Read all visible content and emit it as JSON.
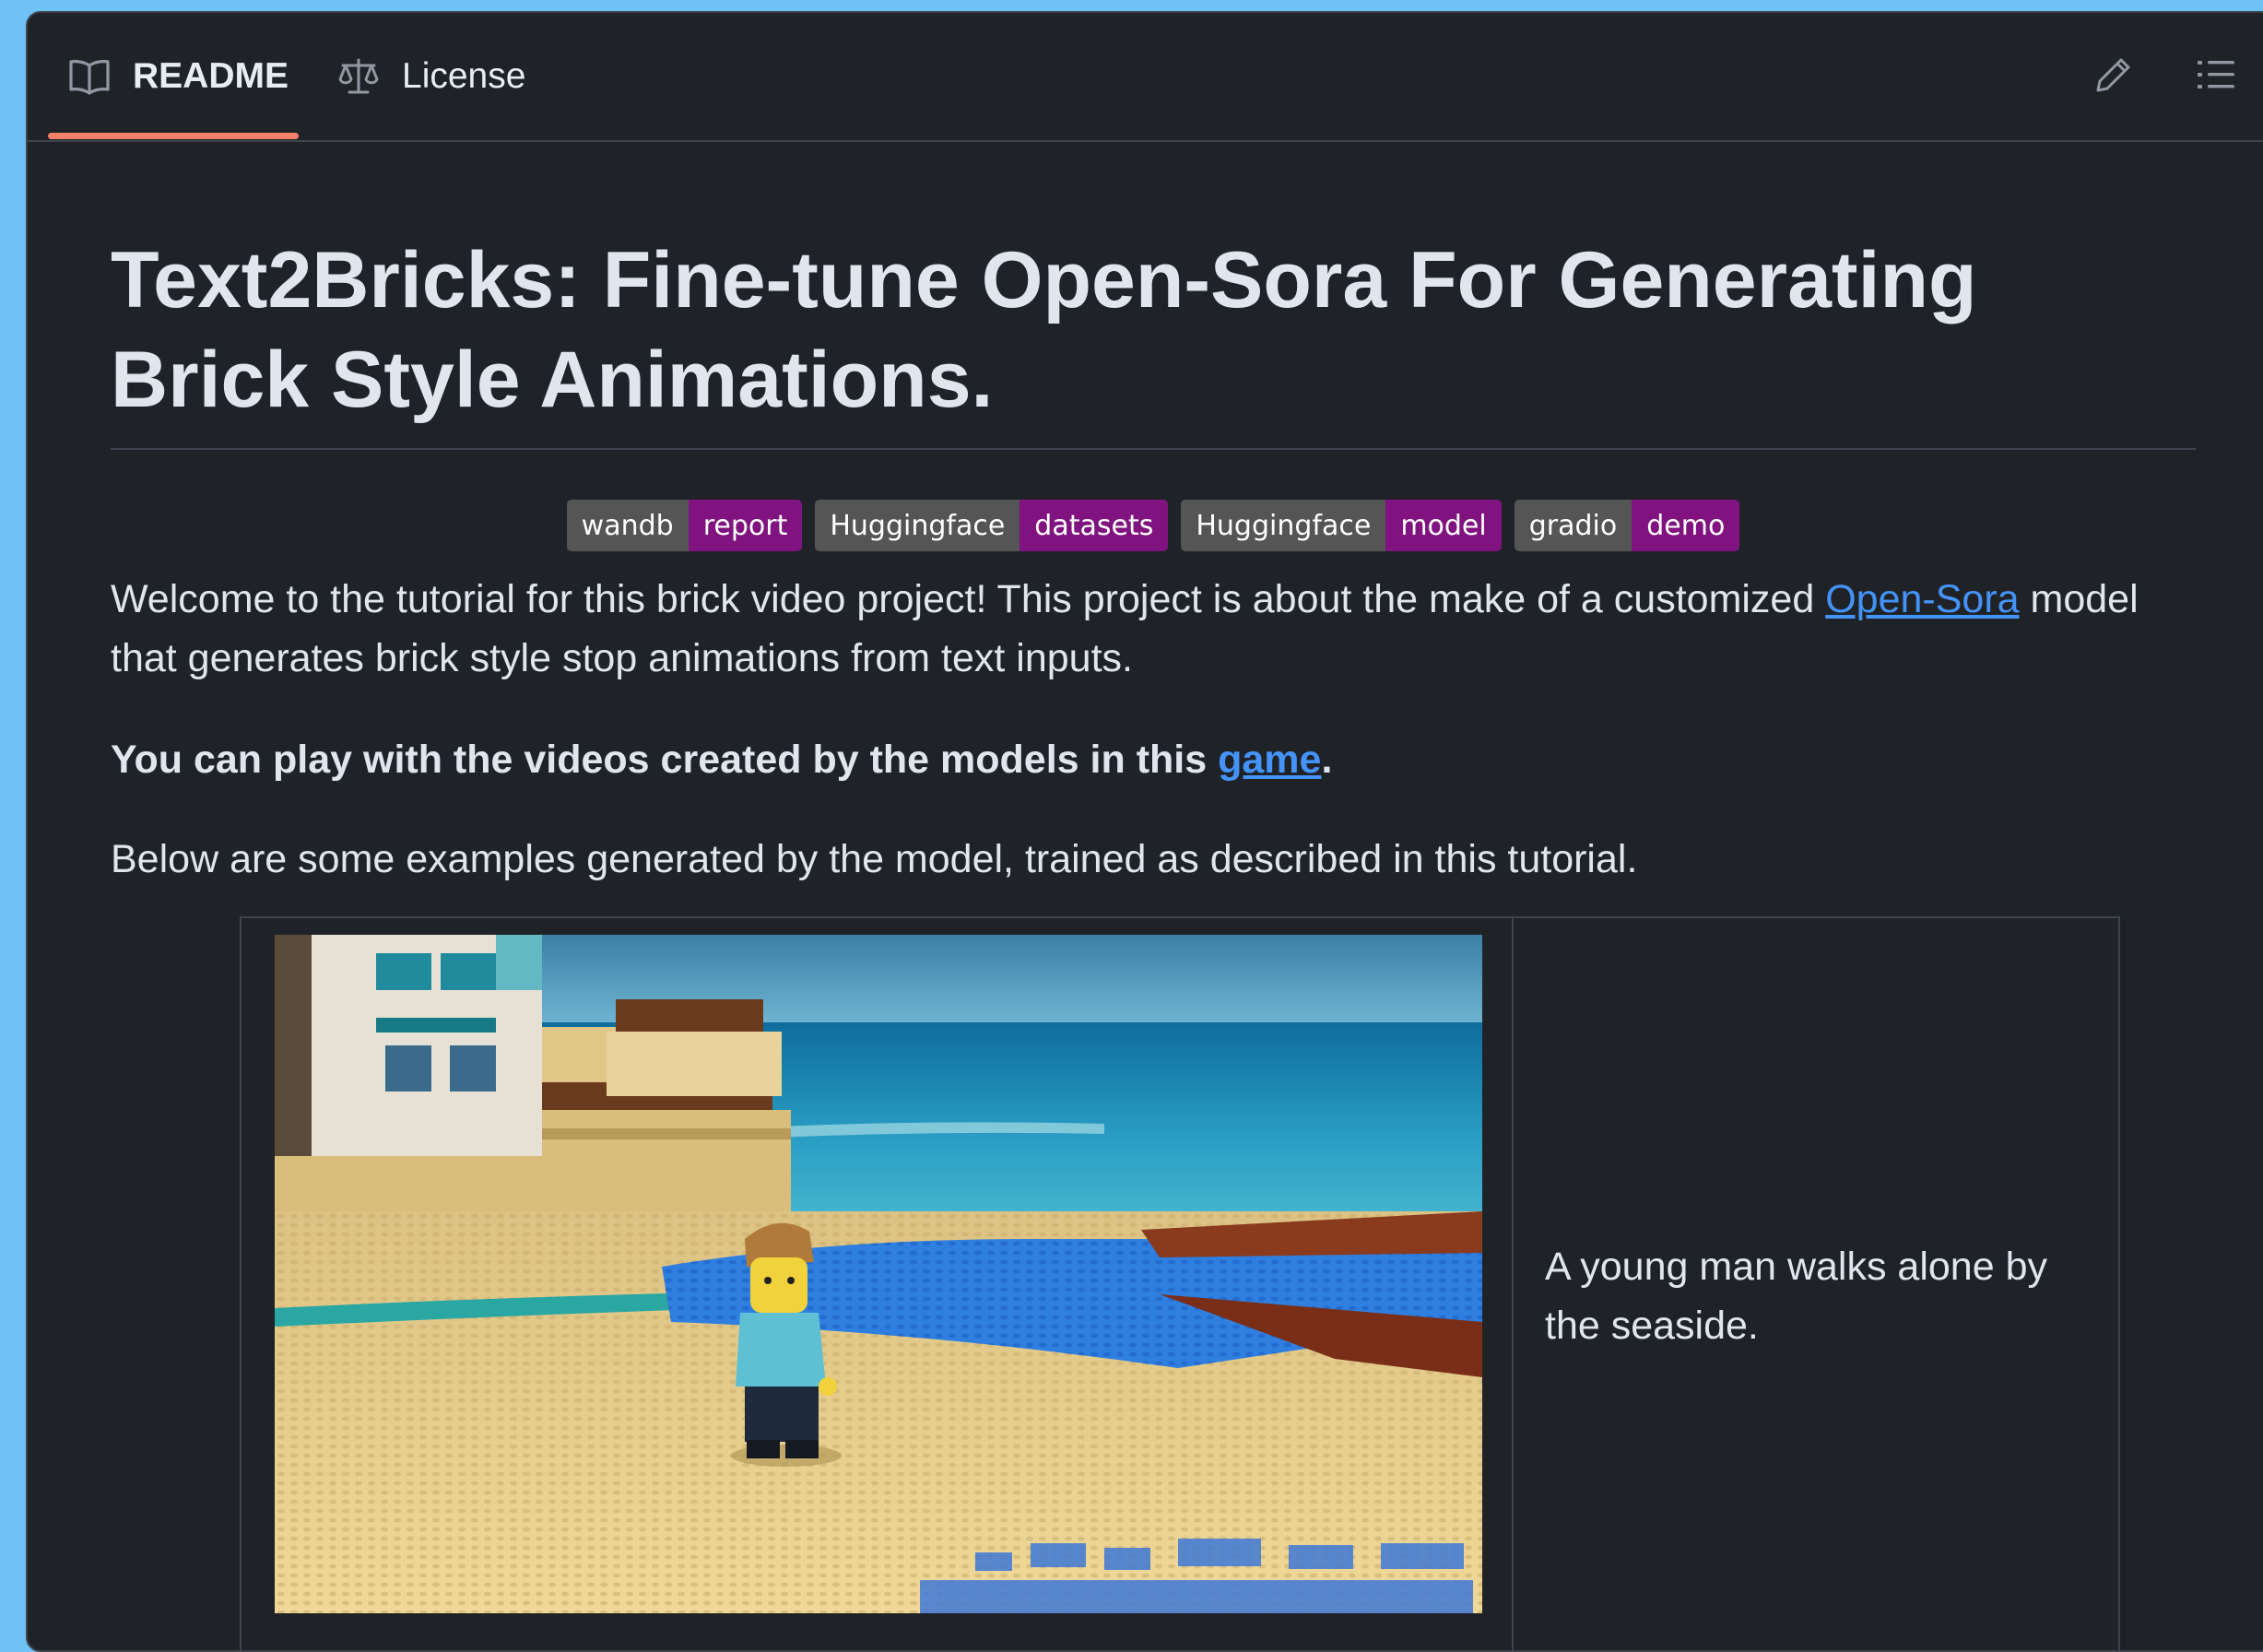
{
  "tabs": {
    "readme_label": "README",
    "license_label": "License"
  },
  "toolbar": {
    "edit_icon": "pencil-icon",
    "outline_icon": "list-unordered-icon"
  },
  "readme": {
    "title": "Text2Bricks: Fine-tune Open-Sora For Generating Brick Style Animations.",
    "badges": [
      {
        "label": "wandb",
        "message": "report"
      },
      {
        "label": "Huggingface",
        "message": "datasets"
      },
      {
        "label": "Huggingface",
        "message": "model"
      },
      {
        "label": "gradio",
        "message": "demo"
      }
    ],
    "intro_text": "Welcome to the tutorial for this brick video project! This project is about the make of a customized ",
    "intro_link": "Open-Sora",
    "intro_text_end": " model that generates brick style stop animations from text inputs.",
    "play_text": "You can play with the videos created by the models in this ",
    "play_link": "game",
    "play_end": ".",
    "examples_text": "Below are some examples generated by the model, trained as described in this tutorial."
  },
  "gallery": {
    "rows": [
      {
        "caption": "A young man walks alone by the seaside."
      }
    ]
  },
  "colors": {
    "page_bg": "#6ec2f5",
    "panel_bg": "#1f2328",
    "text": "#dfe6ee",
    "link": "#4493f8",
    "tab_underline": "#f78166",
    "badge_label": "#555555",
    "badge_message": "#80137f"
  }
}
